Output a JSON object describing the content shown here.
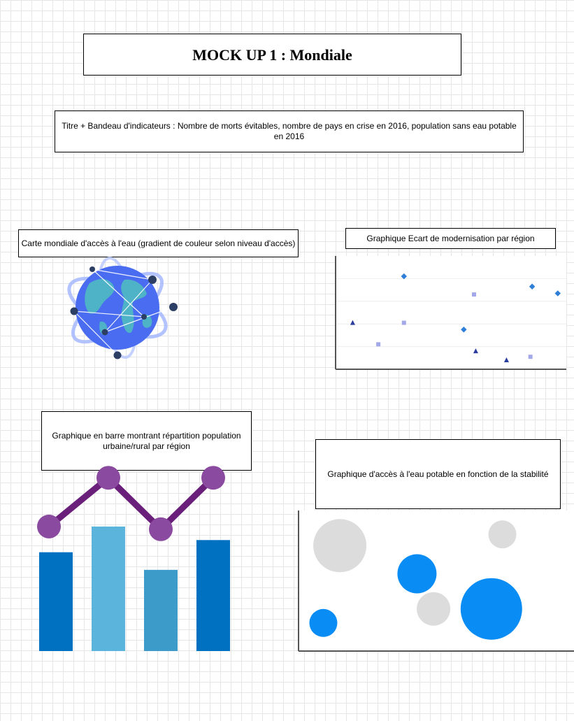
{
  "header": {
    "title": "MOCK UP 1 : Mondiale"
  },
  "banner": {
    "text": "Titre + Bandeau d'indicateurs : Nombre de morts évitables, nombre de pays en crise en 2016, population sans eau potable en 2016"
  },
  "map_panel": {
    "caption": "Carte mondiale d'accès à l'eau (gradient de couleur selon niveau d'accès)",
    "icon": "globe-icon"
  },
  "scatter_panel": {
    "caption": "Graphique Ecart de modernisation par région"
  },
  "bar_panel": {
    "caption": "Graphique en barre montrant répartition population urbaine/rural par région"
  },
  "bubble_panel": {
    "caption": "Graphique d'accès à l'eau potable en fonction de la stabilité"
  },
  "colors": {
    "globe_blue": "#4a6cf0",
    "globe_green": "#4fb3c8",
    "orbit": "#9fb4ff",
    "bar_dark": "#0070c0",
    "bar_light": "#5ab4dc",
    "bar_mid": "#3d9bc9",
    "line_purple": "#6a1f7a",
    "marker_purple": "#8a4aa0",
    "bubble_blue": "#0a8cf5",
    "bubble_gray": "#dcdcdc"
  },
  "chart_data": [
    {
      "type": "scatter",
      "series": [
        {
          "marker": "diamond",
          "color": "#2f7fd8",
          "points": [
            [
              4,
              8.2
            ],
            [
              7.5,
              3.5
            ],
            [
              11.5,
              7.3
            ],
            [
              13,
              6.7
            ]
          ]
        },
        {
          "marker": "square",
          "color": "#a3a8e8",
          "points": [
            [
              2.5,
              2.2
            ],
            [
              4,
              4.1
            ],
            [
              8.1,
              6.6
            ],
            [
              11.4,
              1.1
            ]
          ]
        },
        {
          "marker": "triangle",
          "color": "#2a3c9e",
          "points": [
            [
              1,
              4.1
            ],
            [
              8.2,
              1.6
            ],
            [
              10,
              0.8
            ]
          ]
        }
      ],
      "xlim": [
        0,
        13.5
      ],
      "ylim": [
        0,
        10
      ],
      "grid": true
    },
    {
      "type": "bar",
      "values": [
        73,
        92,
        60,
        82
      ],
      "bar_colors": [
        "#0070c0",
        "#5ab4dc",
        "#3d9bc9",
        "#0070c0"
      ],
      "line_values": [
        92,
        128,
        90,
        128
      ],
      "ylim": [
        0,
        140
      ]
    },
    {
      "type": "scatter",
      "bubbles": [
        {
          "x": 1.5,
          "y": 7.5,
          "size": 38,
          "color": "#dcdcdc"
        },
        {
          "x": 4.3,
          "y": 5.5,
          "size": 28,
          "color": "#0a8cf5"
        },
        {
          "x": 7.4,
          "y": 8.3,
          "size": 20,
          "color": "#dcdcdc"
        },
        {
          "x": 0.9,
          "y": 2.0,
          "size": 20,
          "color": "#0a8cf5"
        },
        {
          "x": 4.9,
          "y": 3.0,
          "size": 24,
          "color": "#dcdcdc"
        },
        {
          "x": 7.0,
          "y": 3.0,
          "size": 44,
          "color": "#0a8cf5"
        }
      ],
      "xlim": [
        0,
        10
      ],
      "ylim": [
        0,
        10
      ]
    }
  ]
}
